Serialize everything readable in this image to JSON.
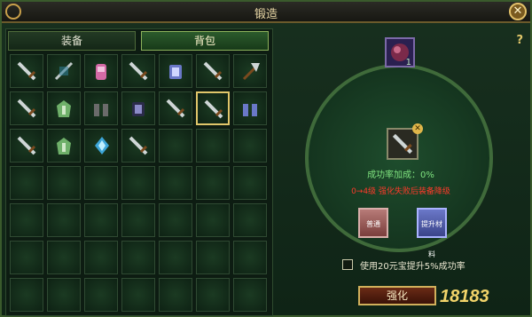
{
  "window": {
    "title": "锻造"
  },
  "tabs": [
    {
      "label": "装备"
    },
    {
      "label": "背包"
    }
  ],
  "inventory": {
    "columns": 7,
    "rows": 7,
    "items": [
      {
        "icon": "sword-icon"
      },
      {
        "icon": "spear-icon"
      },
      {
        "icon": "pink-armor-icon"
      },
      {
        "icon": "sword-icon"
      },
      {
        "icon": "blue-armor-icon"
      },
      {
        "icon": "sword-icon"
      },
      {
        "icon": "axe-icon"
      },
      {
        "icon": "sword-icon"
      },
      {
        "icon": "green-robe-icon"
      },
      {
        "icon": "boots-icon"
      },
      {
        "icon": "dark-armor-icon"
      },
      {
        "icon": "sword-icon"
      },
      {
        "icon": "sword-icon",
        "selected": true
      },
      {
        "icon": "boots-blue-icon"
      },
      {
        "icon": "sword-icon"
      },
      {
        "icon": "green-robe-icon"
      },
      {
        "icon": "blue-crystal-icon"
      },
      {
        "icon": "sword-icon"
      }
    ]
  },
  "forge": {
    "help": "?",
    "material_slot": {
      "icon": "purple-gem-icon",
      "count": "1"
    },
    "equip_slot": {
      "icon": "sword-icon",
      "close": "✕"
    },
    "success_rate_text": "成功率加成：0%",
    "warning_text": "0→4级 强化失败后装备降级",
    "stone_left": {
      "text": "普通"
    },
    "stone_right": {
      "text": "提升材料"
    },
    "checkbox_label": "使用20元宝提升5%成功率",
    "strengthen_button": "强化",
    "brand_text": "18183"
  },
  "colors": {
    "accent_gold": "#e0c66a",
    "success_green": "#7fe27f",
    "warning_red": "#ff3a2a"
  }
}
